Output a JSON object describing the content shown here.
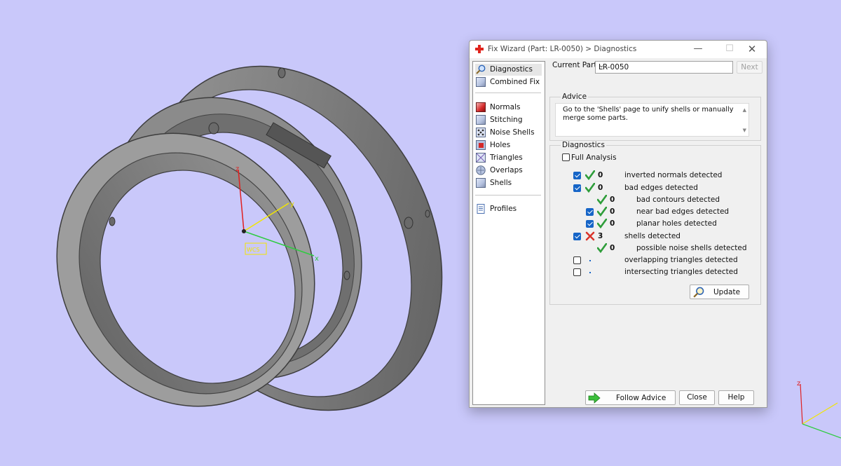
{
  "window": {
    "title": "Fix Wizard (Part: LR-0050) > Diagnostics",
    "minimize_glyph": "—",
    "maximize_glyph": "☐",
    "close_glyph": "✕"
  },
  "nav": {
    "items": [
      {
        "label": "Diagnostics",
        "icon": "magnifier-icon"
      },
      {
        "label": "Combined Fix",
        "icon": "cube-icon"
      },
      {
        "label": "Normals",
        "icon": "normals-cube-icon"
      },
      {
        "label": "Stitching",
        "icon": "stitching-cube-icon"
      },
      {
        "label": "Noise Shells",
        "icon": "noise-shells-icon"
      },
      {
        "label": "Holes",
        "icon": "holes-cube-icon"
      },
      {
        "label": "Triangles",
        "icon": "triangles-cube-icon"
      },
      {
        "label": "Overlaps",
        "icon": "overlaps-icon"
      },
      {
        "label": "Shells",
        "icon": "shells-cube-icon"
      },
      {
        "label": "Profiles",
        "icon": "document-icon"
      }
    ],
    "selected": "Diagnostics"
  },
  "current_part": {
    "label": "Current Part:",
    "value": "LR-0050"
  },
  "next_label": "Next",
  "advice": {
    "legend": "Advice",
    "text": "Go to the 'Shells' page to unify shells or manually merge some parts."
  },
  "diagnostics": {
    "legend": "Diagnostics",
    "full_analysis_label": "Full Analysis",
    "rows": [
      {
        "checked": true,
        "status": "ok",
        "count": "0",
        "text": "inverted normals detected"
      },
      {
        "checked": true,
        "status": "ok",
        "count": "0",
        "text": "bad edges detected"
      },
      {
        "checked": null,
        "status": "ok",
        "count": "0",
        "text": "bad contours detected"
      },
      {
        "checked": true,
        "status": "ok",
        "count": "0",
        "text": "near bad edges detected"
      },
      {
        "checked": true,
        "status": "ok",
        "count": "0",
        "text": "planar holes detected"
      },
      {
        "checked": true,
        "status": "error",
        "count": "3",
        "text": "shells detected"
      },
      {
        "checked": null,
        "status": "ok",
        "count": "0",
        "text": "possible noise shells detected"
      },
      {
        "checked": false,
        "status": "none",
        "count": "",
        "text": "overlapping triangles detected"
      },
      {
        "checked": false,
        "status": "none",
        "count": "",
        "text": "intersecting triangles detected"
      }
    ]
  },
  "buttons": {
    "update": "Update",
    "follow_advice": "Follow Advice",
    "close": "Close",
    "help": "Help"
  },
  "viewport": {
    "background": "#c9c8fa",
    "axis_labels": {
      "x": "x",
      "y": "y",
      "z": "z"
    },
    "origin_label": "WCS"
  },
  "colors": {
    "ok": "#2e9d3a",
    "error": "#d9342b",
    "check_blue": "#1665c7",
    "axis_x": "#2ecc40",
    "axis_y": "#f2e600",
    "axis_z": "#e02020"
  }
}
